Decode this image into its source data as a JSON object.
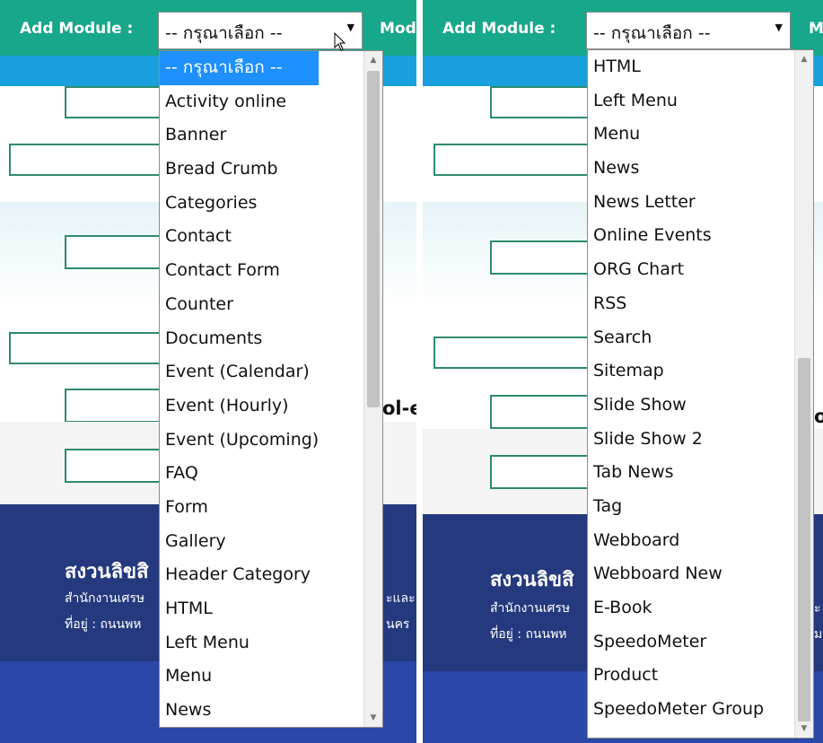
{
  "toolbar": {
    "label": "Add Module :",
    "select_value": "-- กรุณาเลือก --",
    "cut_label_left": "Mod",
    "cut_label_right": "M"
  },
  "page": {
    "bold_cut_left": "ol-e",
    "bold_cut_right": "o",
    "footer_title": "สงวนลิขสิ",
    "footer_line1_left": "สำนักงานเศรษ",
    "footer_line1_right_frag": "ะและ",
    "footer_line2_left": "ที่อยู่ : ถนนพห",
    "footer_line2_right_frag": "นคร",
    "footer_line1_panel2": "สำนักงานเศรษ",
    "footer_line2_panel2": "ที่อยู่ : ถนนพห",
    "footer_frag_panel2_1": "ะ",
    "footer_frag_panel2_2": "ม"
  },
  "dropdown_left": {
    "items": [
      "-- กรุณาเลือก --",
      "Activity online",
      "Banner",
      "Bread Crumb",
      "Categories",
      "Contact",
      "Contact Form",
      "Counter",
      "Documents",
      "Event (Calendar)",
      "Event (Hourly)",
      "Event (Upcoming)",
      "FAQ",
      "Form",
      "Gallery",
      "Header Category",
      "HTML",
      "Left Menu",
      "Menu",
      "News"
    ],
    "selected_index": 0
  },
  "dropdown_right": {
    "items": [
      "HTML",
      "Left Menu",
      "Menu",
      "News",
      "News Letter",
      "Online Events",
      "ORG Chart",
      "RSS",
      "Search",
      "Sitemap",
      "Slide Show",
      "Slide Show 2",
      "Tab News",
      "Tag",
      "Webboard",
      "Webboard New",
      "E-Book",
      "SpeedoMeter",
      "Product",
      "SpeedoMeter Group"
    ],
    "scroll_position": 1.0
  },
  "colors": {
    "toolbar": "#17a78a",
    "selected_option": "#1e90ff",
    "footer": "#25397f"
  },
  "icons": {
    "dropdown_arrow": "triangle-down",
    "scroll_up": "triangle-up",
    "scroll_down": "triangle-down",
    "cursor": "mouse-pointer"
  }
}
